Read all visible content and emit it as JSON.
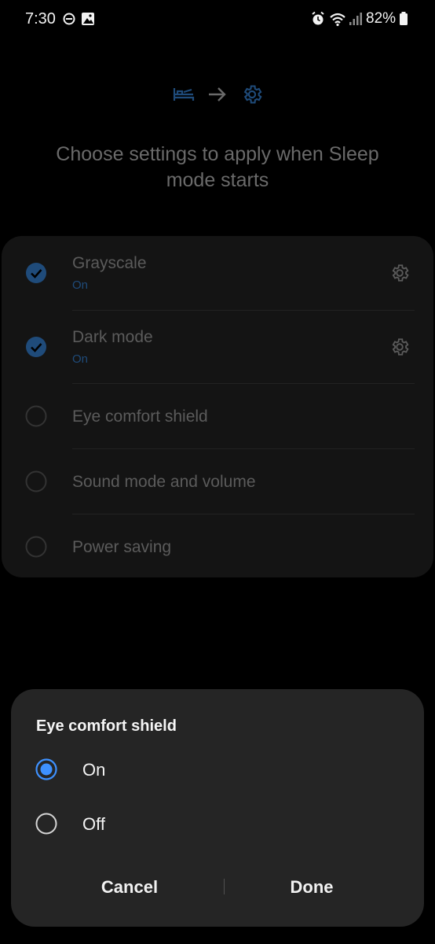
{
  "status_bar": {
    "time": "7:30",
    "battery_level": "82%",
    "icons": [
      "do-not-disturb-icon",
      "gallery-icon",
      "alarm-icon",
      "wifi-icon",
      "signal-icon",
      "battery-icon"
    ]
  },
  "page": {
    "hero_icons": [
      "bed-icon",
      "arrow-right-icon",
      "gear-icon"
    ],
    "title": "Choose settings to apply when Sleep mode starts",
    "settings": [
      {
        "label": "Grayscale",
        "status": "On",
        "checked": true,
        "has_settings": true
      },
      {
        "label": "Dark mode",
        "status": "On",
        "checked": true,
        "has_settings": true
      },
      {
        "label": "Eye comfort shield",
        "checked": false,
        "has_settings": false
      },
      {
        "label": "Sound mode and volume",
        "checked": false,
        "has_settings": false
      },
      {
        "label": "Power saving",
        "checked": false,
        "has_settings": false
      }
    ]
  },
  "dialog": {
    "title": "Eye comfort shield",
    "options": [
      {
        "label": "On",
        "selected": true
      },
      {
        "label": "Off",
        "selected": false
      }
    ],
    "cancel_label": "Cancel",
    "done_label": "Done"
  },
  "colors": {
    "accent": "#3e91ff",
    "dim_accent": "#1f4b7a",
    "dialog_bg": "#252525",
    "card_bg": "#141414"
  }
}
